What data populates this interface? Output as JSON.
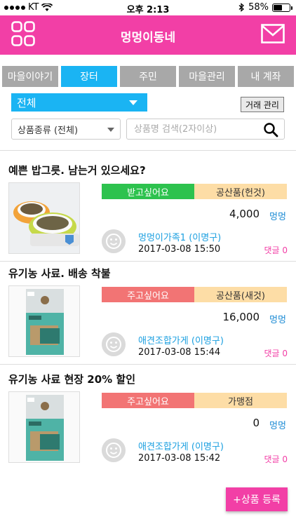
{
  "status_bar": {
    "carrier": "KT",
    "time": "오후 2:13",
    "battery": "58%",
    "battery_level": 0.58
  },
  "header": {
    "title": "멍멍이동네",
    "color": "#f23fa6"
  },
  "tabs": [
    {
      "label": "마을이야기",
      "active": false
    },
    {
      "label": "장터",
      "active": true
    },
    {
      "label": "주민",
      "active": false
    },
    {
      "label": "마을관리",
      "active": false
    },
    {
      "label": "내 계좌",
      "active": false
    }
  ],
  "filters": {
    "region_select": "전체",
    "trade_manage_label": "거래 관리",
    "category_select": "상품종류 (전체)",
    "search_placeholder": "상품명 검색(2자이상)"
  },
  "listings": [
    {
      "title": "예쁜 밥그릇. 남는거 있으세요?",
      "trade_type": "받고싶어요",
      "trade_color": "green",
      "kind": "공산품(헌것)",
      "price": "4,000",
      "unit": "멍멍",
      "seller": "멍멍이가족1 (이명구)",
      "date": "2017-03-08 15:50",
      "comments": "댓글 0"
    },
    {
      "title": "유기농 사료. 배송 착불",
      "trade_type": "주고싶어요",
      "trade_color": "red",
      "kind": "공산품(새것)",
      "price": "16,000",
      "unit": "멍멍",
      "seller": "애견조합가게 (이명구)",
      "date": "2017-03-08 15:44",
      "comments": "댓글 0"
    },
    {
      "title": "유기농 사료 현장 20% 할인",
      "trade_type": "주고싶어요",
      "trade_color": "red",
      "kind": "가맹점",
      "price": "0",
      "unit": "멍멍",
      "seller": "애견조합가게 (이명구)",
      "date": "2017-03-08 15:42",
      "comments": "댓글 0"
    }
  ],
  "add_button": {
    "label": "+상품 등록"
  },
  "colors": {
    "pink": "#f23fa6",
    "blue": "#1ab4f3",
    "green": "#2dc24e",
    "red": "#f27474",
    "beige": "#fddda6"
  }
}
